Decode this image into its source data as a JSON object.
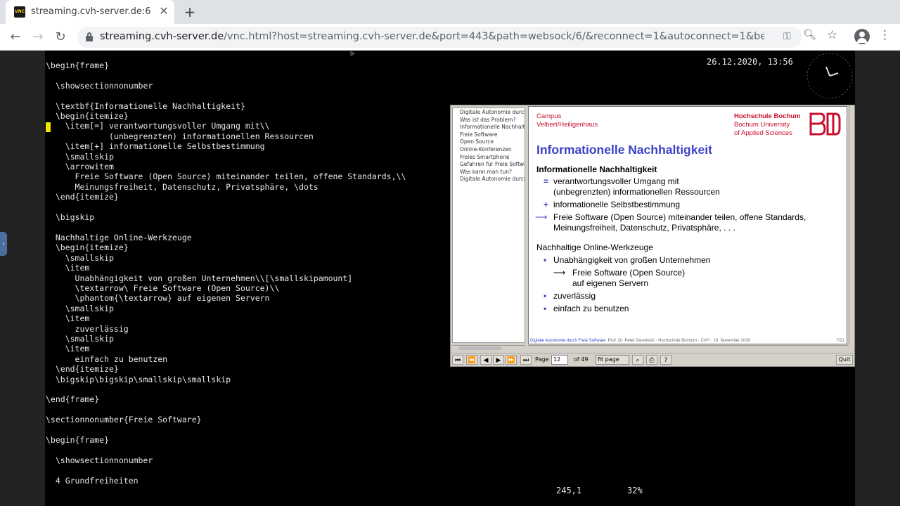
{
  "browser": {
    "tab_title": "streaming.cvh-server.de:6",
    "tab_favicon": "VNC",
    "new_tab": "+",
    "close": "✕",
    "url_host": "streaming.cvh-server.de",
    "url_path": "/vnc.html?host=streaming.cvh-server.de&port=443&path=websock/6/&reconnect=1&autoconnect=1&bell..."
  },
  "editor": {
    "lines_before_cursor": "\\begin{frame}\n\n  \\showsectionnonumber\n\n  \\textbf{Informationelle Nachhaltigkeit}\n  \\begin{itemize}\n",
    "cursor_line": "    \\item[=] verantwortungsvoller Umgang mit\\\\",
    "lines_after_cursor": "             (unbegrenzten) informationellen Ressourcen\n    \\item[+] informationelle Selbstbestimmung\n    \\smallskip\n    \\arrowitem\n      Freie Software (Open Source) miteinander teilen, offene Standards,\\\\\n      Meinungsfreiheit, Datenschutz, Privatsphäre, \\dots\n  \\end{itemize}\n\n  \\bigskip\n\n  Nachhaltige Online-Werkzeuge\n  \\begin{itemize}\n    \\smallskip\n    \\item\n      Unabhängigkeit von großen Unternehmen\\\\[\\smallskipamount]\n      \\textarrow\\ Freie Software (Open Source)\\\\\n      \\phantom{\\textarrow} auf eigenen Servern\n    \\smallskip\n    \\item\n      zuverlässig\n    \\smallskip\n    \\item\n      einfach zu benutzen\n  \\end{itemize}\n  \\bigskip\\bigskip\\smallskip\\smallskip\n\n\\end{frame}\n\n\\sectionnonumber{Freie Software}\n\n\\begin{frame}\n\n  \\showsectionnonumber\n\n  4 Grundfreiheiten"
  },
  "status": {
    "datetime": "26.12.2020, 13:56",
    "position": "245,1",
    "percent": "32%"
  },
  "pdf": {
    "outline": [
      "Digitale Autonomie durch F",
      "Was ist das Problem?",
      "Informationelle Nachhaltigk",
      "Freie Software",
      "Open Source",
      "Online-Konferenzen",
      "Freies Smartphone",
      "Gefahren für Freie Software",
      "Was kann man tun?",
      "Digitale Autonomie durch F"
    ],
    "slide": {
      "campus_line1": "Campus",
      "campus_line2": "Velbert/Heiligenhaus",
      "uni_line1": "Hochschule Bochum",
      "uni_line2": "Bochum University",
      "uni_line3": "of Applied Sciences",
      "title": "Informationelle Nachhaltigkeit",
      "heading1": "Informationelle Nachhaltigkeit",
      "item1_mark": "=",
      "item1_line1": "verantwortungsvoller Umgang mit",
      "item1_line2": "(unbegrenzten) informationellen Ressourcen",
      "item2_mark": "+",
      "item2_text": "informationelle Selbstbestimmung",
      "item3_line1": "Freie Software (Open Source) miteinander teilen, offene Standards,",
      "item3_line2": "Meinungsfreiheit, Datenschutz, Privatsphäre, . . .",
      "heading2": "Nachhaltige Online-Werkzeuge",
      "bullet1": "Unabhängigkeit von großen Unternehmen",
      "bullet1_sub1": "Freie Software (Open Source)",
      "bullet1_sub2": "auf eigenen Servern",
      "bullet2": "zuverlässig",
      "bullet3": "einfach zu benutzen",
      "footer_blue": "Digitale Autonomie durch Freie Software",
      "footer_rest": "Prof. Dr. Peter Gerwinski · Hochschule Bochum · CVH · 19. November 2020",
      "page_no": "7/21"
    },
    "toolbar": {
      "page_label": "Page",
      "page_value": "12",
      "of_label": "of 49",
      "zoom_value": "fit page",
      "quit": "Quit"
    }
  },
  "colors": {
    "accent_blue": "#3a43c4",
    "brand_red": "#c8102e",
    "cursor_yellow": "#f2e600"
  }
}
